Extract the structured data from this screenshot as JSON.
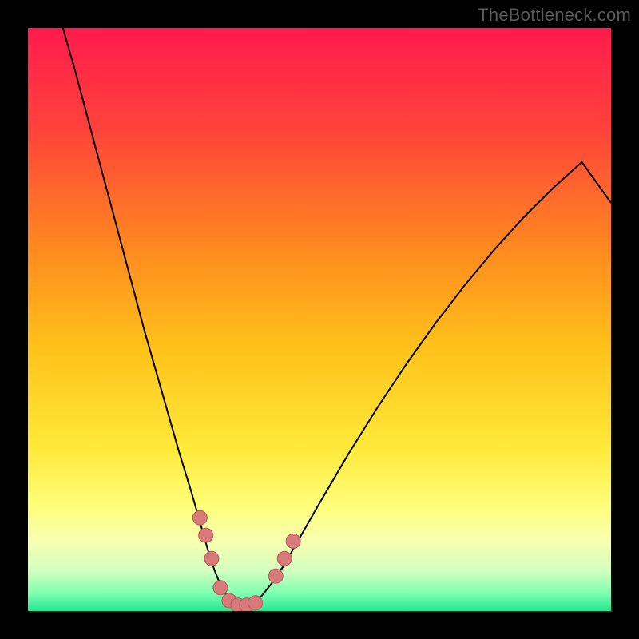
{
  "watermark": "TheBottleneck.com",
  "chart_data": {
    "type": "line",
    "title": "",
    "xlabel": "",
    "ylabel": "",
    "xlim": [
      0,
      100
    ],
    "ylim": [
      0,
      100
    ],
    "grid": false,
    "legend": false,
    "background_gradient": {
      "stops": [
        {
          "offset": 0.0,
          "color": "#ff1b4d"
        },
        {
          "offset": 0.18,
          "color": "#ff443a"
        },
        {
          "offset": 0.38,
          "color": "#ff8a1f"
        },
        {
          "offset": 0.55,
          "color": "#ffc21a"
        },
        {
          "offset": 0.72,
          "color": "#ffe93a"
        },
        {
          "offset": 0.82,
          "color": "#fffe7a"
        },
        {
          "offset": 0.88,
          "color": "#f7ffb0"
        },
        {
          "offset": 0.93,
          "color": "#d4ffc0"
        },
        {
          "offset": 0.97,
          "color": "#7dffb0"
        },
        {
          "offset": 1.0,
          "color": "#20e890"
        }
      ]
    },
    "series": [
      {
        "name": "bottleneck-curve",
        "stroke": "#000000",
        "stroke_width": 2,
        "x": [
          6.0,
          8.0,
          10.0,
          12.0,
          14.0,
          16.0,
          18.0,
          20.0,
          22.0,
          24.0,
          26.0,
          28.0,
          29.0,
          30.0,
          31.0,
          32.0,
          33.0,
          34.0,
          35.0,
          36.0,
          37.0,
          38.0,
          40.0,
          42.0,
          44.0,
          46.0,
          50.0,
          55.0,
          60.0,
          65.0,
          70.0,
          75.0,
          80.0,
          85.0,
          90.0,
          95.0,
          100.0
        ],
        "y": [
          100.0,
          93.0,
          85.5,
          78.0,
          70.5,
          63.0,
          55.5,
          48.0,
          41.0,
          34.0,
          27.0,
          20.5,
          17.0,
          13.5,
          10.0,
          7.0,
          4.5,
          2.8,
          1.8,
          1.2,
          1.0,
          1.2,
          2.5,
          5.0,
          8.0,
          11.5,
          18.5,
          27.0,
          35.0,
          42.5,
          49.5,
          56.0,
          62.0,
          67.5,
          72.5,
          77.0,
          70.0
        ]
      }
    ],
    "markers": {
      "name": "highlight-points",
      "fill": "#d87a7a",
      "stroke": "#b85a5a",
      "radius": 9,
      "points": [
        {
          "x": 29.5,
          "y": 16.0
        },
        {
          "x": 30.5,
          "y": 13.0
        },
        {
          "x": 31.5,
          "y": 9.0
        },
        {
          "x": 33.0,
          "y": 4.0
        },
        {
          "x": 34.5,
          "y": 1.8
        },
        {
          "x": 36.0,
          "y": 1.0
        },
        {
          "x": 37.5,
          "y": 1.0
        },
        {
          "x": 39.0,
          "y": 1.4
        },
        {
          "x": 42.5,
          "y": 6.0
        },
        {
          "x": 44.0,
          "y": 9.0
        },
        {
          "x": 45.5,
          "y": 12.0
        }
      ]
    }
  }
}
